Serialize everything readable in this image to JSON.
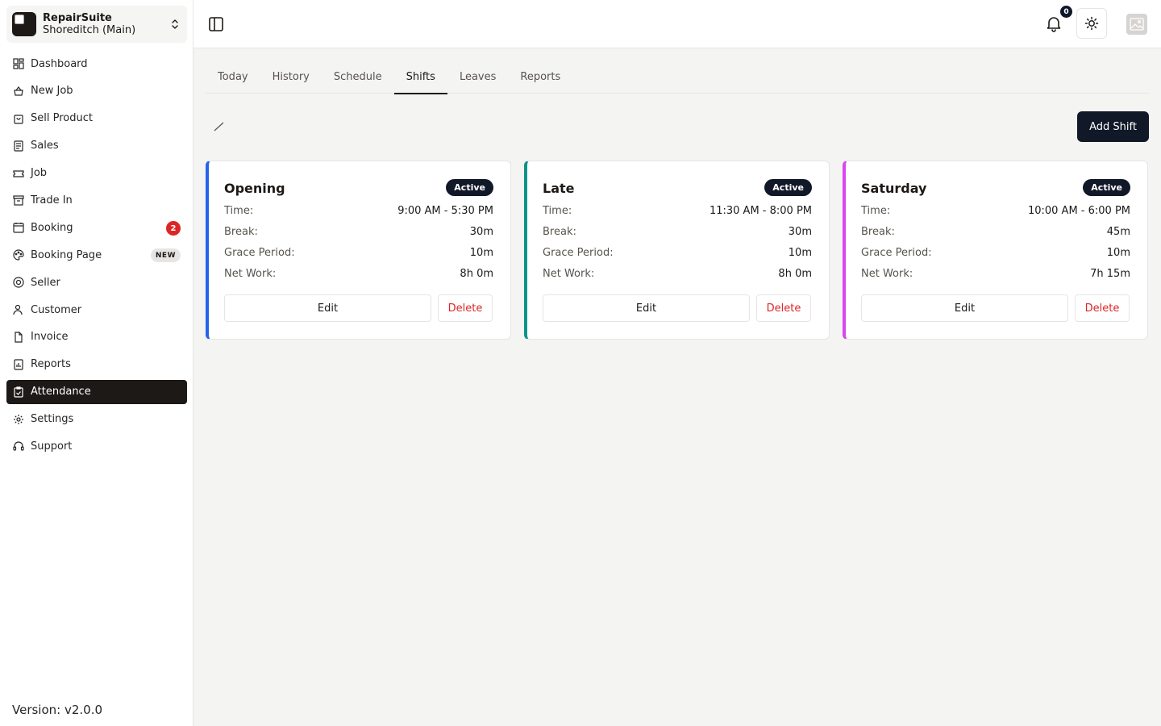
{
  "org": {
    "name": "RepairSuite",
    "branch": "Shoreditch (Main)"
  },
  "nav": [
    {
      "label": "Dashboard",
      "icon": "dashboard-icon"
    },
    {
      "label": "New Job",
      "icon": "new-job-icon"
    },
    {
      "label": "Sell Product",
      "icon": "shopping-bag-icon"
    },
    {
      "label": "Sales",
      "icon": "receipt-icon"
    },
    {
      "label": "Job",
      "icon": "ticket-icon"
    },
    {
      "label": "Trade In",
      "icon": "archive-icon"
    },
    {
      "label": "Booking",
      "icon": "calendar-icon",
      "badge": "2"
    },
    {
      "label": "Booking Page",
      "icon": "palette-icon",
      "tag": "NEW"
    },
    {
      "label": "Seller",
      "icon": "at-sign-icon"
    },
    {
      "label": "Customer",
      "icon": "user-icon"
    },
    {
      "label": "Invoice",
      "icon": "file-icon"
    },
    {
      "label": "Reports",
      "icon": "report-icon"
    },
    {
      "label": "Attendance",
      "icon": "clipboard-check-icon",
      "active": true
    },
    {
      "label": "Settings",
      "icon": "gear-icon"
    },
    {
      "label": "Support",
      "icon": "headset-icon"
    }
  ],
  "version": "Version: v2.0.0",
  "topbar": {
    "notification_count": "0"
  },
  "tabs": [
    {
      "label": "Today"
    },
    {
      "label": "History"
    },
    {
      "label": "Schedule"
    },
    {
      "label": "Shifts",
      "active": true
    },
    {
      "label": "Leaves"
    },
    {
      "label": "Reports"
    }
  ],
  "add_shift_label": "Add Shift",
  "labels": {
    "time": "Time:",
    "break": "Break:",
    "grace": "Grace Period:",
    "net": "Net Work:",
    "edit": "Edit",
    "delete": "Delete"
  },
  "shifts": [
    {
      "name": "Opening",
      "status": "Active",
      "time": "9:00 AM - 5:30 PM",
      "break": "30m",
      "grace": "10m",
      "net": "8h 0m",
      "color": "#2563eb"
    },
    {
      "name": "Late",
      "status": "Active",
      "time": "11:30 AM - 8:00 PM",
      "break": "30m",
      "grace": "10m",
      "net": "8h 0m",
      "color": "#0d9488"
    },
    {
      "name": "Saturday",
      "status": "Active",
      "time": "10:00 AM - 6:00 PM",
      "break": "45m",
      "grace": "10m",
      "net": "7h 15m",
      "color": "#d946ef"
    }
  ]
}
